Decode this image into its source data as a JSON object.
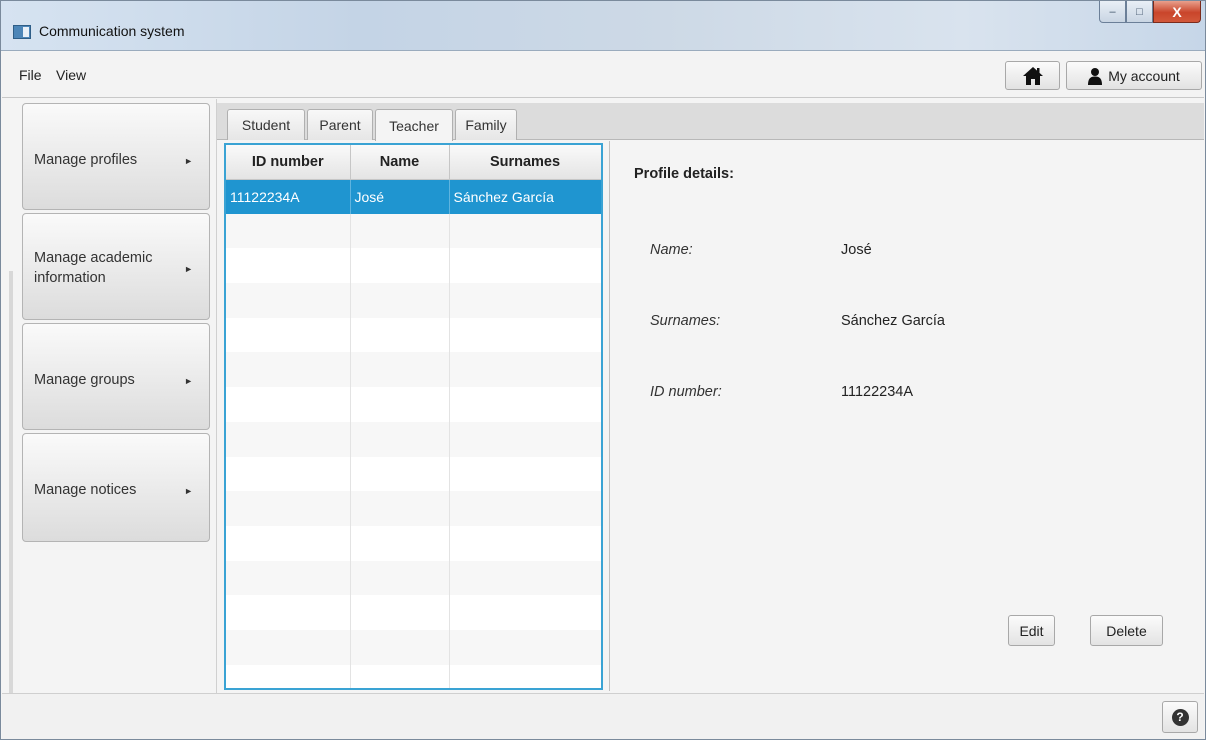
{
  "window": {
    "title": "Communication system",
    "controls": {
      "minimize": "–",
      "maximize": "□",
      "close": "X"
    }
  },
  "menubar": {
    "items": [
      {
        "label": "File"
      },
      {
        "label": "View"
      }
    ],
    "home_icon": "home-icon",
    "account_label": "My account",
    "account_icon": "user-icon"
  },
  "sidebar": {
    "items": [
      {
        "label": "Manage profiles",
        "label_lines": [
          "Manage profiles"
        ]
      },
      {
        "label": "Manage academic information",
        "label_lines": [
          "Manage academic",
          "information"
        ]
      },
      {
        "label": "Manage groups",
        "label_lines": [
          "Manage groups"
        ]
      },
      {
        "label": "Manage notices",
        "label_lines": [
          "Manage notices"
        ]
      }
    ],
    "arrow_glyph": "►"
  },
  "tabs": [
    {
      "label": "Student",
      "selected": false
    },
    {
      "label": "Parent",
      "selected": false
    },
    {
      "label": "Teacher",
      "selected": true
    },
    {
      "label": "Family",
      "selected": false
    }
  ],
  "table": {
    "columns": [
      "ID number",
      "Name",
      "Surnames"
    ],
    "rows": [
      [
        "11122234A",
        "José",
        "Sánchez García"
      ]
    ],
    "selected_row": 0,
    "empty_rows": 14
  },
  "details": {
    "title": "Profile details:",
    "fields": [
      {
        "label": "Name:",
        "value": "José"
      },
      {
        "label": "Surnames:",
        "value": "Sánchez García"
      },
      {
        "label": "ID number:",
        "value": "11122234A"
      }
    ],
    "edit_label": "Edit",
    "delete_label": "Delete"
  },
  "statusbar": {
    "help_glyph": "?",
    "help_icon": "help-icon"
  },
  "colors": {
    "selection": "#1f95d0",
    "table_border": "#3aa3d4",
    "close_button": "#c9452b"
  }
}
